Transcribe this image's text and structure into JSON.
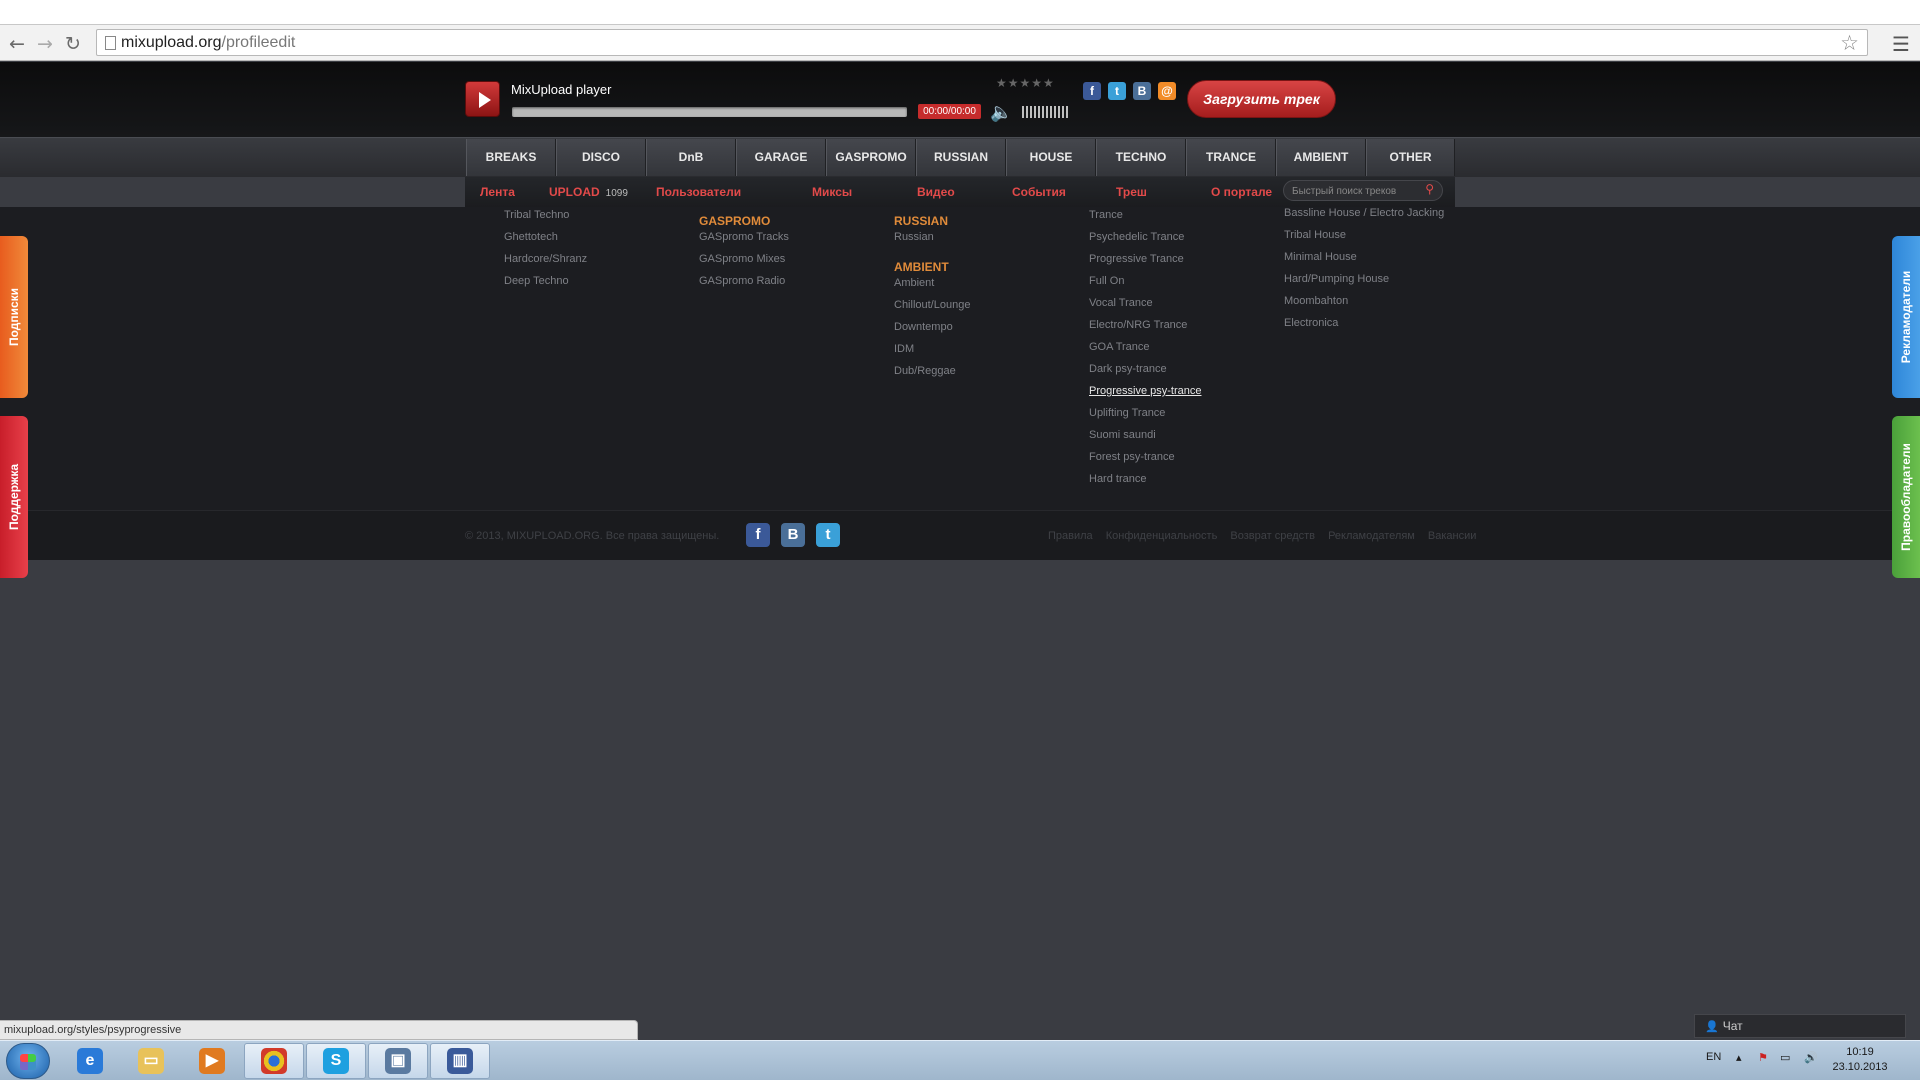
{
  "browser": {
    "url_domain": "mixupload.org",
    "url_path": "/profileedit"
  },
  "player": {
    "title": "MixUpload player",
    "time": "00:00/00:00",
    "rating_stars": 5,
    "progress": 0,
    "upload_button": "Загрузить трек"
  },
  "genre_tabs": [
    "BREAKS",
    "DISCO",
    "DnB",
    "GARAGE",
    "GASPROMO",
    "RUSSIAN",
    "HOUSE",
    "TECHNO",
    "TRANCE",
    "AMBIENT",
    "OTHER"
  ],
  "subnav": {
    "feed": "Лента",
    "upload": "UPLOAD",
    "upload_count": "1099",
    "users": "Пользователи",
    "mixes": "Миксы",
    "video": "Видео",
    "events": "События",
    "trash": "Треш",
    "about": "О портале",
    "search_placeholder": "Быстрый поиск треков"
  },
  "dropdown": {
    "techno": [
      "Tribal Techno",
      "Ghettotech",
      "Hardcore/Shranz",
      "Deep Techno"
    ],
    "gaspromo_head": "GASPROMO",
    "gaspromo": [
      "GASpromo Tracks",
      "GASpromo Mixes",
      "GASpromo Radio"
    ],
    "russian_head": "RUSSIAN",
    "russian": [
      "Russian"
    ],
    "ambient_head": "AMBIENT",
    "ambient": [
      "Ambient",
      "Chillout/Lounge",
      "Downtempo",
      "IDM",
      "Dub/Reggae"
    ],
    "trance": [
      "Trance",
      "Psychedelic Trance",
      "Progressive Trance",
      "Full On",
      "Vocal Trance",
      "Electro/NRG Trance",
      "GOA Trance",
      "Dark psy-trance",
      "Progressive psy-trance",
      "Uplifting Trance",
      "Suomi saundi",
      "Forest psy-trance",
      "Hard trance"
    ],
    "house": [
      "Bassline House / Electro Jacking",
      "Tribal House",
      "Minimal House",
      "Hard/Pumping House",
      "Moombahton",
      "Electronica"
    ]
  },
  "footer": {
    "copyright": "© 2013, MIXUPLOAD.ORG. Все права защищены.",
    "links": [
      "Правила",
      "Конфиденциальность",
      "Возврат средств",
      "Рекламодателям",
      "Вакансии"
    ]
  },
  "side_tabs": {
    "subscriptions": "Подписки",
    "support": "Поддержка",
    "advertisers": "Рекламодатели",
    "rights_holders": "Правообладатели"
  },
  "status_url": "mixupload.org/styles/psyprogressive",
  "chat_label": "Чат",
  "taskbar": {
    "lang": "EN",
    "time": "10:19",
    "date": "23.10.2013"
  },
  "colors": {
    "accent_red": "#e24a4a",
    "heading_orange": "#e08b3a",
    "panel_bg": "#1c1d21"
  }
}
